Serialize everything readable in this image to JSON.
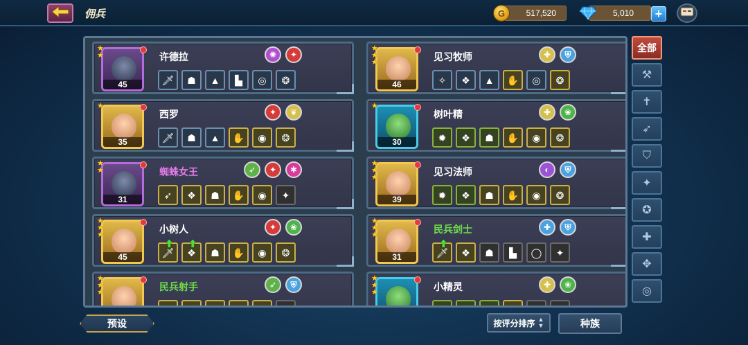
{
  "header": {
    "title": "佣兵",
    "gold": "517,520",
    "gems": "5,010",
    "gold_icon_letter": "G"
  },
  "heroes": [
    {
      "name": "许德拉",
      "level": "45",
      "stars": 2,
      "name_color": "#ffffff",
      "frame": "purple",
      "class_icons": [
        {
          "icon": "poison-icon",
          "color": "#b24fd1",
          "glyph": "✺"
        },
        {
          "icon": "claw-icon",
          "color": "#d73a3a",
          "glyph": "✦"
        }
      ],
      "equipment": [
        {
          "icon": "dagger-icon",
          "tier": "blue",
          "glyph": "🗡"
        },
        {
          "icon": "helmet-icon",
          "tier": "blue",
          "glyph": "☗"
        },
        {
          "icon": "armor-icon",
          "tier": "blue",
          "glyph": "▲"
        },
        {
          "icon": "boot-icon",
          "tier": "blue",
          "glyph": "▙"
        },
        {
          "icon": "ring-icon",
          "tier": "blue",
          "glyph": "◎"
        },
        {
          "icon": "horn-icon",
          "tier": "blue",
          "glyph": "❂"
        }
      ]
    },
    {
      "name": "见习牧师",
      "level": "46",
      "stars": 3,
      "name_color": "#ffffff",
      "frame": "gold",
      "class_icons": [
        {
          "icon": "holy-icon",
          "color": "#d6c04b",
          "glyph": "✚"
        },
        {
          "icon": "knight-helm-icon",
          "color": "#4aa3e0",
          "glyph": "⛨"
        }
      ],
      "equipment": [
        {
          "icon": "rune-icon",
          "tier": "blue",
          "glyph": "✧"
        },
        {
          "icon": "tome-icon",
          "tier": "blue",
          "glyph": "❖"
        },
        {
          "icon": "armor-icon",
          "tier": "blue",
          "glyph": "▲"
        },
        {
          "icon": "gauntlet-icon",
          "tier": "gold",
          "glyph": "✋"
        },
        {
          "icon": "ring-icon",
          "tier": "blue",
          "glyph": "◎"
        },
        {
          "icon": "horn-icon",
          "tier": "gold",
          "glyph": "❂"
        }
      ]
    },
    {
      "name": "西罗",
      "level": "35",
      "stars": 1,
      "name_color": "#ffffff",
      "frame": "gold",
      "class_icons": [
        {
          "icon": "claw-icon",
          "color": "#d73a3a",
          "glyph": "✦"
        },
        {
          "icon": "wing-icon",
          "color": "#d6c04b",
          "glyph": "❦"
        }
      ],
      "equipment": [
        {
          "icon": "sword-icon",
          "tier": "blue",
          "glyph": "🗡"
        },
        {
          "icon": "helmet-icon",
          "tier": "blue",
          "glyph": "☗"
        },
        {
          "icon": "armor-icon",
          "tier": "blue",
          "glyph": "▲"
        },
        {
          "icon": "gauntlet-icon",
          "tier": "gold",
          "glyph": "✋"
        },
        {
          "icon": "ring-icon",
          "tier": "gold",
          "glyph": "◉"
        },
        {
          "icon": "horn-icon",
          "tier": "gold",
          "glyph": "❂"
        }
      ]
    },
    {
      "name": "树叶精",
      "level": "30",
      "stars": 1,
      "name_color": "#ffffff",
      "frame": "blue",
      "class_icons": [
        {
          "icon": "holy-icon",
          "color": "#d6c04b",
          "glyph": "✚"
        },
        {
          "icon": "nature-icon",
          "color": "#4fb24a",
          "glyph": "❀"
        }
      ],
      "equipment": [
        {
          "icon": "gear-icon",
          "tier": "green",
          "glyph": "✹"
        },
        {
          "icon": "tome-icon",
          "tier": "green",
          "glyph": "❖"
        },
        {
          "icon": "helmet-icon",
          "tier": "green",
          "glyph": "☗"
        },
        {
          "icon": "gauntlet-icon",
          "tier": "gold",
          "glyph": "✋"
        },
        {
          "icon": "ring-icon",
          "tier": "gold",
          "glyph": "◉"
        },
        {
          "icon": "horn-icon",
          "tier": "gold",
          "glyph": "❂"
        }
      ]
    },
    {
      "name": "蜘蛛女王",
      "level": "31",
      "stars": 2,
      "name_color": "#e07be8",
      "frame": "purple",
      "class_icons": [
        {
          "icon": "bow-icon",
          "color": "#5fb24a",
          "glyph": "➶"
        },
        {
          "icon": "claw-icon",
          "color": "#d73a3a",
          "glyph": "✦"
        },
        {
          "icon": "spider-icon",
          "color": "#d73a9a",
          "glyph": "✱"
        }
      ],
      "equipment": [
        {
          "icon": "bow-icon",
          "tier": "gold",
          "glyph": "➶"
        },
        {
          "icon": "tome-icon",
          "tier": "gold",
          "glyph": "❖"
        },
        {
          "icon": "helmet-icon",
          "tier": "gold",
          "glyph": "☗"
        },
        {
          "icon": "gauntlet-icon",
          "tier": "gold",
          "glyph": "✋"
        },
        {
          "icon": "ring-icon",
          "tier": "gold",
          "glyph": "◉"
        },
        {
          "icon": "axe-icon",
          "tier": "grey",
          "glyph": "✦"
        }
      ]
    },
    {
      "name": "见习法师",
      "level": "39",
      "stars": 3,
      "name_color": "#ffffff",
      "frame": "gold",
      "class_icons": [
        {
          "icon": "arcane-icon",
          "color": "#9b54d6",
          "glyph": "◐"
        },
        {
          "icon": "knight-helm-icon",
          "color": "#4aa3e0",
          "glyph": "⛨"
        }
      ],
      "equipment": [
        {
          "icon": "gear-icon",
          "tier": "green",
          "glyph": "✹"
        },
        {
          "icon": "tome-icon",
          "tier": "green",
          "glyph": "❖"
        },
        {
          "icon": "helmet-icon",
          "tier": "gold",
          "glyph": "☗"
        },
        {
          "icon": "gauntlet-icon",
          "tier": "gold",
          "glyph": "✋"
        },
        {
          "icon": "ring-icon",
          "tier": "gold",
          "glyph": "◉"
        },
        {
          "icon": "horn-icon",
          "tier": "gold",
          "glyph": "❂"
        }
      ]
    },
    {
      "name": "小树人",
      "level": "45",
      "stars": 3,
      "name_color": "#ffffff",
      "frame": "gold",
      "class_icons": [
        {
          "icon": "claw-icon",
          "color": "#d73a3a",
          "glyph": "✦"
        },
        {
          "icon": "nature-icon",
          "color": "#4fb24a",
          "glyph": "❀"
        }
      ],
      "equipment": [
        {
          "icon": "sword-icon",
          "tier": "gold",
          "glyph": "🗡",
          "upgrade": true
        },
        {
          "icon": "tome-icon",
          "tier": "gold",
          "glyph": "❖",
          "upgrade": true
        },
        {
          "icon": "helmet-icon",
          "tier": "gold",
          "glyph": "☗"
        },
        {
          "icon": "gauntlet-icon",
          "tier": "gold",
          "glyph": "✋"
        },
        {
          "icon": "ring-icon",
          "tier": "gold",
          "glyph": "◉"
        },
        {
          "icon": "horn-icon",
          "tier": "gold",
          "glyph": "❂"
        }
      ]
    },
    {
      "name": "民兵剑士",
      "level": "31",
      "stars": 3,
      "name_color": "#6fdc4a",
      "frame": "gold",
      "class_icons": [
        {
          "icon": "holy-cross-icon",
          "color": "#4aa3e0",
          "glyph": "✚"
        },
        {
          "icon": "knight-helm-icon",
          "color": "#4aa3e0",
          "glyph": "⛨"
        }
      ],
      "equipment": [
        {
          "icon": "sword-icon",
          "tier": "gold",
          "glyph": "🗡",
          "upgrade": true
        },
        {
          "icon": "tome-icon",
          "tier": "gold",
          "glyph": "❖"
        },
        {
          "icon": "helmet-icon",
          "tier": "grey",
          "glyph": "☗"
        },
        {
          "icon": "boot-icon",
          "tier": "grey",
          "glyph": "▙"
        },
        {
          "icon": "ring-icon",
          "tier": "grey",
          "glyph": "◯"
        },
        {
          "icon": "axe-icon",
          "tier": "grey",
          "glyph": "✦"
        }
      ]
    },
    {
      "name": "民兵射手",
      "level": "",
      "stars": 3,
      "name_color": "#6fdc4a",
      "frame": "gold",
      "class_icons": [
        {
          "icon": "bow-icon",
          "color": "#5fb24a",
          "glyph": "➶"
        },
        {
          "icon": "knight-helm-icon",
          "color": "#4aa3e0",
          "glyph": "⛨"
        }
      ],
      "equipment": [
        {
          "icon": "bow-icon",
          "tier": "gold",
          "glyph": "➶"
        },
        {
          "icon": "tome-icon",
          "tier": "gold",
          "glyph": "❖"
        },
        {
          "icon": "helmet-icon",
          "tier": "gold",
          "glyph": "☗"
        },
        {
          "icon": "gauntlet-icon",
          "tier": "gold",
          "glyph": "✋"
        },
        {
          "icon": "ring-icon",
          "tier": "gold",
          "glyph": "◉"
        },
        {
          "icon": "axe-icon",
          "tier": "grey",
          "glyph": "✦"
        }
      ]
    },
    {
      "name": "小精灵",
      "level": "",
      "stars": 3,
      "name_color": "#ffffff",
      "frame": "blue",
      "class_icons": [
        {
          "icon": "holy-icon",
          "color": "#d6c04b",
          "glyph": "✚"
        },
        {
          "icon": "nature-icon",
          "color": "#4fb24a",
          "glyph": "❀"
        }
      ],
      "equipment": [
        {
          "icon": "gear-icon",
          "tier": "green",
          "glyph": "✹"
        },
        {
          "icon": "tome-icon",
          "tier": "green",
          "glyph": "❖"
        },
        {
          "icon": "helmet-icon",
          "tier": "green",
          "glyph": "☗"
        },
        {
          "icon": "gauntlet-icon",
          "tier": "gold",
          "glyph": "✋"
        },
        {
          "icon": "ring-icon",
          "tier": "grey",
          "glyph": "◯"
        },
        {
          "icon": "axe-icon",
          "tier": "grey",
          "glyph": "✦"
        }
      ]
    }
  ],
  "side_tabs": [
    {
      "label": "全部",
      "icon": "all-icon",
      "active": true
    },
    {
      "label": "",
      "icon": "hammer-icon",
      "glyph": "⚒"
    },
    {
      "label": "",
      "icon": "cross-icon",
      "glyph": "✝"
    },
    {
      "label": "",
      "icon": "bow-icon",
      "glyph": "➶"
    },
    {
      "label": "",
      "icon": "shield-icon",
      "glyph": "⛉"
    },
    {
      "label": "",
      "icon": "shuriken-icon",
      "glyph": "✦"
    },
    {
      "label": "",
      "icon": "rune-circle-icon",
      "glyph": "✪"
    },
    {
      "label": "",
      "icon": "holy-cross-icon",
      "glyph": "✚"
    },
    {
      "label": "",
      "icon": "spin-icon",
      "glyph": "✥"
    },
    {
      "label": "",
      "icon": "target-icon",
      "glyph": "◎"
    }
  ],
  "footer": {
    "preset_label": "预设",
    "sort_label": "按评分排序",
    "race_label": "种族"
  }
}
